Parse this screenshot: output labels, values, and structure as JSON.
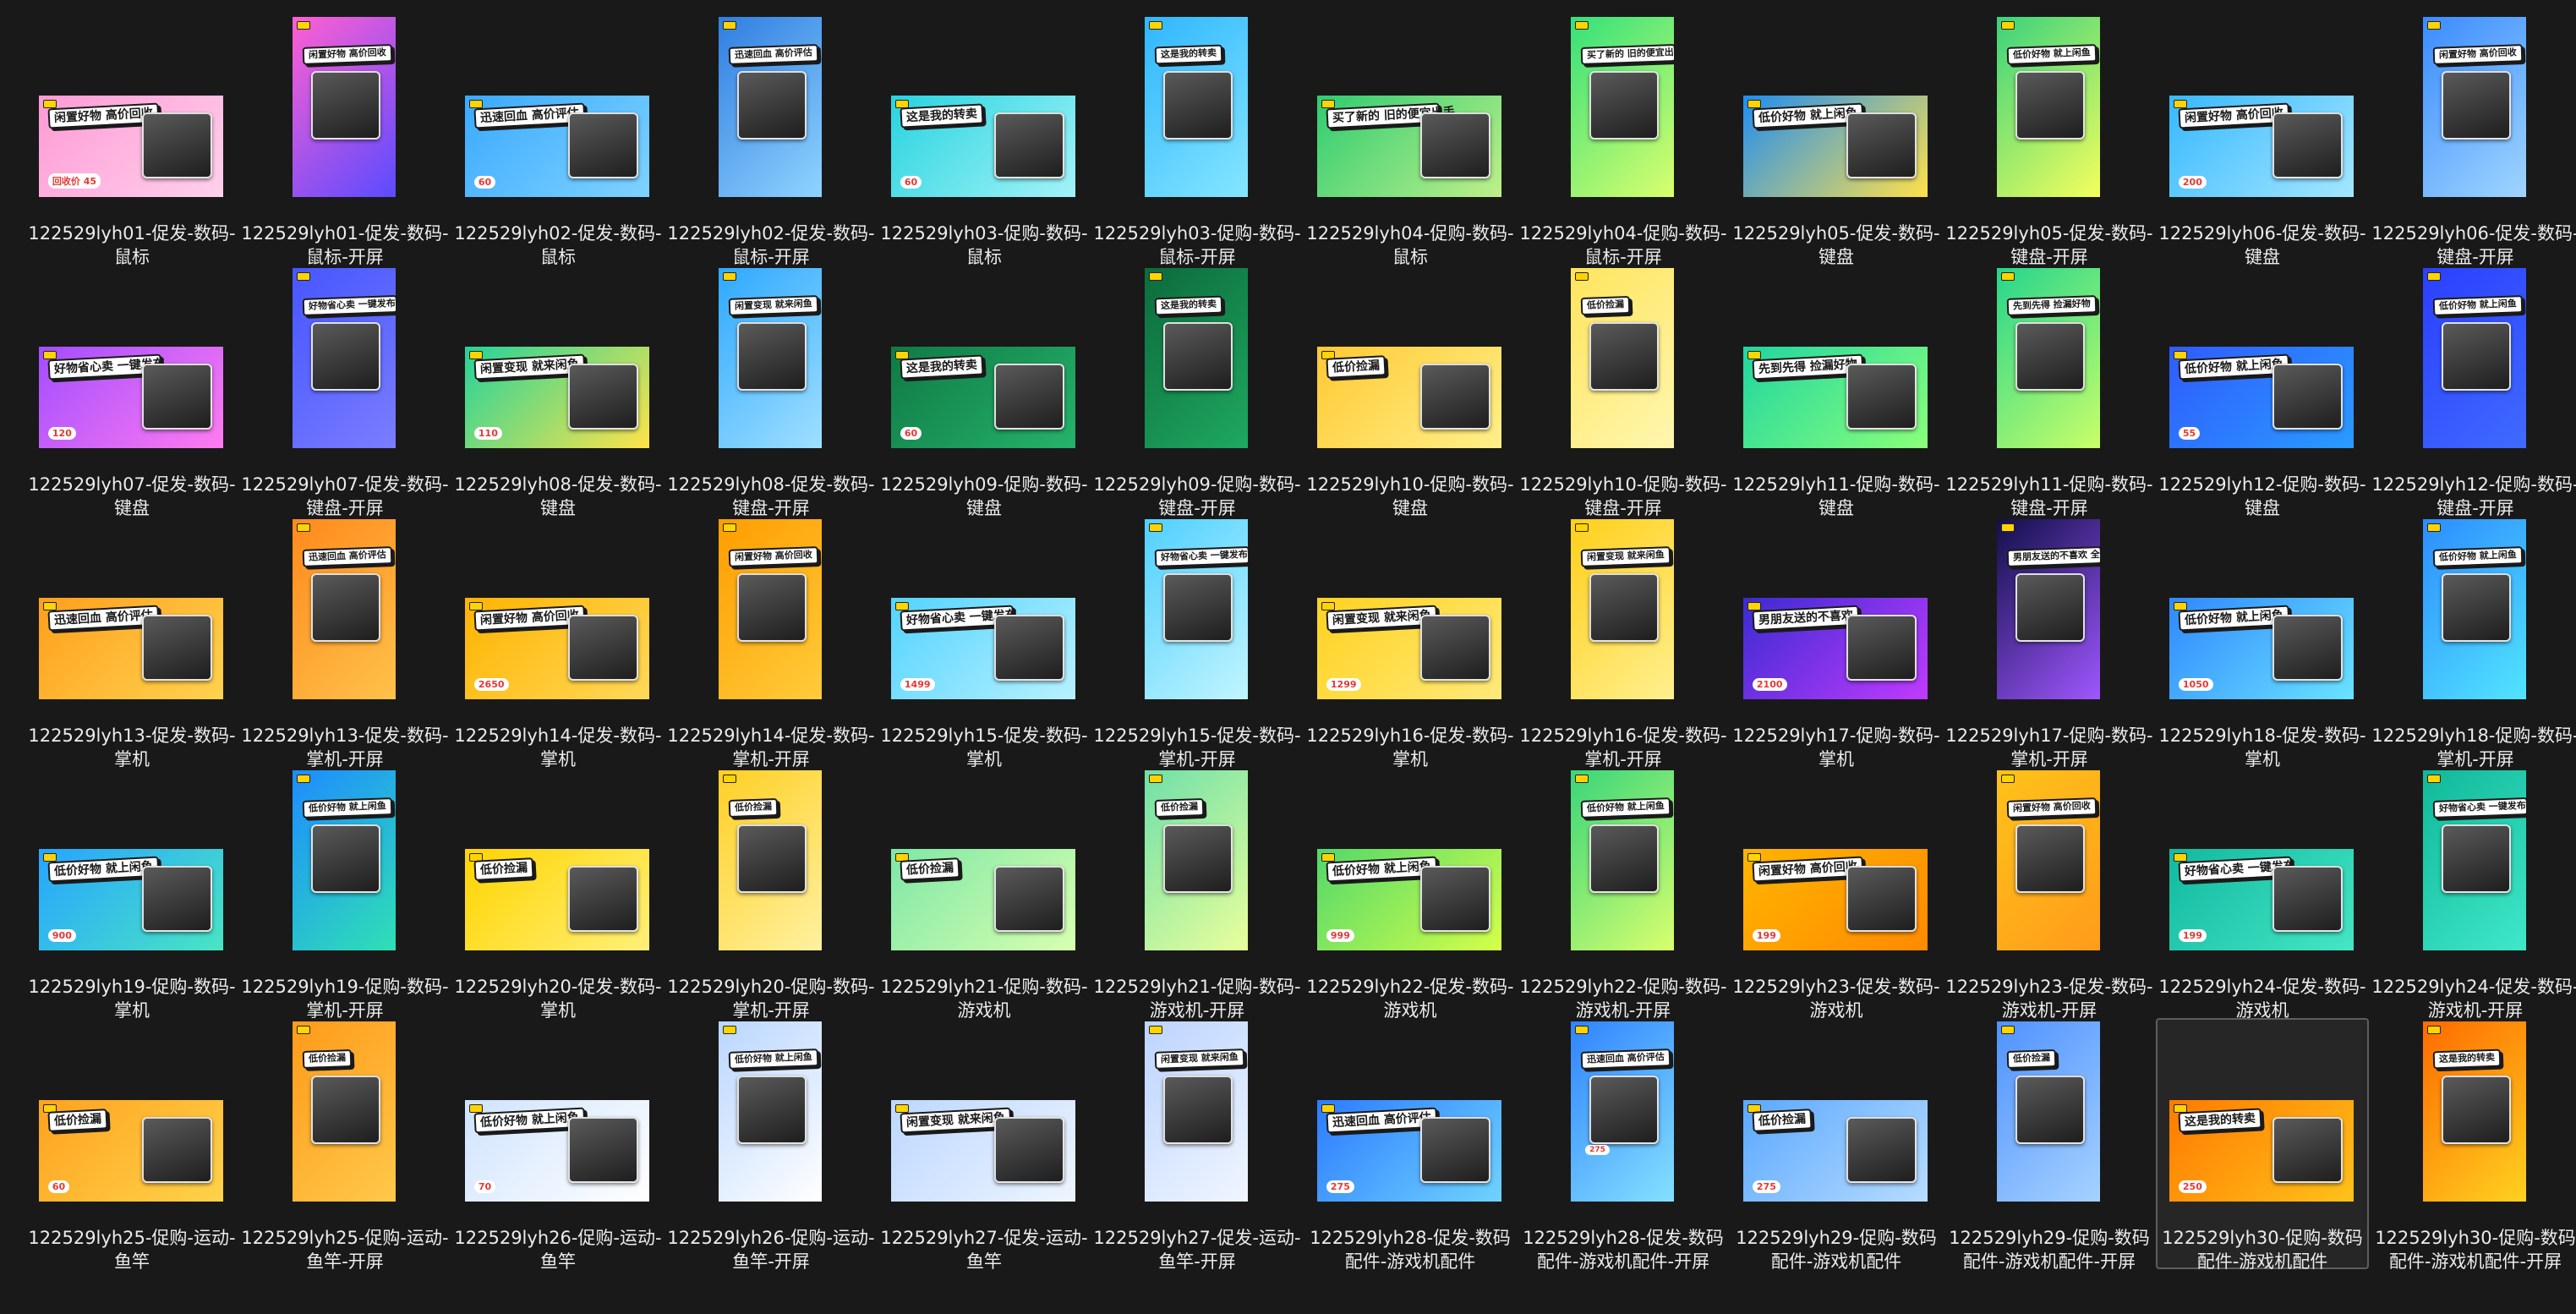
{
  "files": [
    {
      "name": "122529lyh01-促发-数码-鼠标",
      "orientation": "landscape",
      "headline": "闲置好物 高价回收",
      "price": "回收价 45",
      "colors": [
        "#ff9ad5",
        "#ffd1ec"
      ],
      "selected": false
    },
    {
      "name": "122529lyh01-促发-数码-鼠标-开屏",
      "orientation": "portrait",
      "headline": "闲置好物 高价回收",
      "price": "",
      "colors": [
        "#ff5fd2",
        "#5b4bff"
      ],
      "selected": false
    },
    {
      "name": "122529lyh02-促发-数码-鼠标",
      "orientation": "landscape",
      "headline": "迅速回血 高价评估",
      "price": "60",
      "colors": [
        "#3aa9ff",
        "#7fd3ff"
      ],
      "selected": false
    },
    {
      "name": "122529lyh02-促发-数码-鼠标-开屏",
      "orientation": "portrait",
      "headline": "迅速回血 高价评估",
      "price": "",
      "colors": [
        "#2f7de1",
        "#8fd4ff"
      ],
      "selected": false
    },
    {
      "name": "122529lyh03-促购-数码-鼠标",
      "orientation": "landscape",
      "headline": "这是我的转卖",
      "price": "60",
      "colors": [
        "#27d3e0",
        "#a3f3f7"
      ],
      "selected": false
    },
    {
      "name": "122529lyh03-促购-数码-鼠标-开屏",
      "orientation": "portrait",
      "headline": "这是我的转卖",
      "price": "",
      "colors": [
        "#2fb6ff",
        "#85e6ff"
      ],
      "selected": false
    },
    {
      "name": "122529lyh04-促购-数码-鼠标",
      "orientation": "landscape",
      "headline": "买了新的 旧的便宜出手",
      "price": "",
      "colors": [
        "#2ecc71",
        "#bff08a"
      ],
      "selected": false
    },
    {
      "name": "122529lyh04-促购-数码-鼠标-开屏",
      "orientation": "portrait",
      "headline": "买了新的 旧的便宜出手",
      "price": "",
      "colors": [
        "#34e07a",
        "#d9ff6e"
      ],
      "selected": false
    },
    {
      "name": "122529lyh05-促发-数码-键盘",
      "orientation": "landscape",
      "headline": "低价好物 就上闲鱼",
      "price": "",
      "colors": [
        "#1f8df2",
        "#ffe14a"
      ],
      "selected": false
    },
    {
      "name": "122529lyh05-促发-数码-键盘-开屏",
      "orientation": "portrait",
      "headline": "低价好物 就上闲鱼",
      "price": "",
      "colors": [
        "#39d27c",
        "#f4ff5e"
      ],
      "selected": false
    },
    {
      "name": "122529lyh06-促发-数码-键盘",
      "orientation": "landscape",
      "headline": "闲置好物 高价回收",
      "price": "200",
      "colors": [
        "#37b8ff",
        "#a4e7ff"
      ],
      "selected": false
    },
    {
      "name": "122529lyh06-促发-数码-键盘-开屏",
      "orientation": "portrait",
      "headline": "闲置好物 高价回收",
      "price": "",
      "colors": [
        "#3a8bff",
        "#9fd5ff"
      ],
      "selected": false
    },
    {
      "name": "122529lyh07-促发-数码-键盘",
      "orientation": "landscape",
      "headline": "好物省心卖 一键发布",
      "price": "120",
      "colors": [
        "#a24dff",
        "#ff7cf0"
      ],
      "selected": false
    },
    {
      "name": "122529lyh07-促发-数码-键盘-开屏",
      "orientation": "portrait",
      "headline": "好物省心卖 一键发布",
      "price": "",
      "colors": [
        "#4656ff",
        "#7a7dff"
      ],
      "selected": false
    },
    {
      "name": "122529lyh08-促发-数码-键盘",
      "orientation": "landscape",
      "headline": "闲置变现 就来闲鱼",
      "price": "110",
      "colors": [
        "#22d39a",
        "#ffe34a"
      ],
      "selected": false
    },
    {
      "name": "122529lyh08-促发-数码-键盘-开屏",
      "orientation": "portrait",
      "headline": "闲置变现 就来闲鱼",
      "price": "",
      "colors": [
        "#2ea8ff",
        "#9fe0ff"
      ],
      "selected": false
    },
    {
      "name": "122529lyh09-促购-数码-键盘",
      "orientation": "landscape",
      "headline": "这是我的转卖",
      "price": "60",
      "colors": [
        "#0f7a45",
        "#26b36b"
      ],
      "selected": false
    },
    {
      "name": "122529lyh09-促购-数码-键盘-开屏",
      "orientation": "portrait",
      "headline": "这是我的转卖",
      "price": "",
      "colors": [
        "#0c6b3c",
        "#1fa860"
      ],
      "selected": false
    },
    {
      "name": "122529lyh10-促购-数码-键盘",
      "orientation": "landscape",
      "headline": "低价捡漏",
      "price": "",
      "colors": [
        "#ffc933",
        "#fff08a"
      ],
      "selected": false
    },
    {
      "name": "122529lyh10-促购-数码-键盘-开屏",
      "orientation": "portrait",
      "headline": "低价捡漏",
      "price": "",
      "colors": [
        "#ffe45c",
        "#fff7b0"
      ],
      "selected": false
    },
    {
      "name": "122529lyh11-促购-数码-键盘",
      "orientation": "landscape",
      "headline": "先到先得 捡漏好物",
      "price": "",
      "colors": [
        "#1fd6a0",
        "#8bff7a"
      ],
      "selected": false
    },
    {
      "name": "122529lyh11-促购-数码-键盘-开屏",
      "orientation": "portrait",
      "headline": "先到先得 捡漏好物",
      "price": "",
      "colors": [
        "#25d58c",
        "#c9ff6a"
      ],
      "selected": false
    },
    {
      "name": "122529lyh12-促购-数码-键盘",
      "orientation": "landscape",
      "headline": "低价好物 就上闲鱼",
      "price": "55",
      "colors": [
        "#2f5cff",
        "#2a9bff"
      ],
      "selected": false
    },
    {
      "name": "122529lyh12-促购-数码-键盘-开屏",
      "orientation": "portrait",
      "headline": "低价好物 就上闲鱼",
      "price": "",
      "colors": [
        "#2b3fff",
        "#3f6bff"
      ],
      "selected": false
    },
    {
      "name": "122529lyh13-促发-数码-掌机",
      "orientation": "landscape",
      "headline": "迅速回血 高价评估",
      "price": "",
      "colors": [
        "#ff9f1c",
        "#ffd34f"
      ],
      "selected": false
    },
    {
      "name": "122529lyh13-促发-数码-掌机-开屏",
      "orientation": "portrait",
      "headline": "迅速回血 高价评估",
      "price": "",
      "colors": [
        "#ff8a1c",
        "#ffc24a"
      ],
      "selected": false
    },
    {
      "name": "122529lyh14-促发-数码-掌机",
      "orientation": "landscape",
      "headline": "闲置好物 高价回收",
      "price": "2650",
      "colors": [
        "#ffb300",
        "#ffd95a"
      ],
      "selected": false
    },
    {
      "name": "122529lyh14-促发-数码-掌机-开屏",
      "orientation": "portrait",
      "headline": "闲置好物 高价回收",
      "price": "",
      "colors": [
        "#ff9d00",
        "#ffcc3a"
      ],
      "selected": false
    },
    {
      "name": "122529lyh15-促发-数码-掌机",
      "orientation": "landscape",
      "headline": "好物省心卖 一键发布",
      "price": "1499",
      "colors": [
        "#53d3ff",
        "#b8f1ff"
      ],
      "selected": false
    },
    {
      "name": "122529lyh15-促发-数码-掌机-开屏",
      "orientation": "portrait",
      "headline": "好物省心卖 一键发布",
      "price": "",
      "colors": [
        "#4fd0ff",
        "#c2f5ff"
      ],
      "selected": false
    },
    {
      "name": "122529lyh16-促发-数码-掌机",
      "orientation": "landscape",
      "headline": "闲置变现 就来闲鱼",
      "price": "1299",
      "colors": [
        "#ffd21f",
        "#ffe97a"
      ],
      "selected": false
    },
    {
      "name": "122529lyh16-促发-数码-掌机-开屏",
      "orientation": "portrait",
      "headline": "闲置变现 就来闲鱼",
      "price": "",
      "colors": [
        "#ffcf1a",
        "#fff08f"
      ],
      "selected": false
    },
    {
      "name": "122529lyh17-促购-数码-掌机",
      "orientation": "landscape",
      "headline": "男朋友送的不喜欢",
      "price": "2100",
      "colors": [
        "#3b2bd1",
        "#c13bff"
      ],
      "selected": false
    },
    {
      "name": "122529lyh17-促购-数码-掌机-开屏",
      "orientation": "portrait",
      "headline": "男朋友送的不喜欢 全新低价出手",
      "price": "",
      "colors": [
        "#120f4a",
        "#9f57ff"
      ],
      "selected": false
    },
    {
      "name": "122529lyh18-促发-数码-掌机",
      "orientation": "landscape",
      "headline": "低价好物 就上闲鱼",
      "price": "1050",
      "colors": [
        "#2f88ff",
        "#6ae3ff"
      ],
      "selected": false
    },
    {
      "name": "122529lyh18-促购-数码-掌机-开屏",
      "orientation": "portrait",
      "headline": "低价好物 就上闲鱼",
      "price": "",
      "colors": [
        "#2c8cff",
        "#52e5ff"
      ],
      "selected": false
    },
    {
      "name": "122529lyh19-促购-数码-掌机",
      "orientation": "landscape",
      "headline": "低价好物 就上闲鱼",
      "price": "900",
      "colors": [
        "#27a4ff",
        "#49e5c3"
      ],
      "selected": false
    },
    {
      "name": "122529lyh19-促购-数码-掌机-开屏",
      "orientation": "portrait",
      "headline": "低价好物 就上闲鱼",
      "price": "",
      "colors": [
        "#1d8cff",
        "#2fe0b5"
      ],
      "selected": false
    },
    {
      "name": "122529lyh20-促发-数码-掌机",
      "orientation": "landscape",
      "headline": "低价捡漏",
      "price": "",
      "colors": [
        "#ffd400",
        "#fff07a"
      ],
      "selected": false
    },
    {
      "name": "122529lyh20-促购-数码-掌机-开屏",
      "orientation": "portrait",
      "headline": "低价捡漏",
      "price": "",
      "colors": [
        "#ffcf24",
        "#fff1a0"
      ],
      "selected": false
    },
    {
      "name": "122529lyh21-促购-数码-游戏机",
      "orientation": "landscape",
      "headline": "低价捡漏",
      "price": "",
      "colors": [
        "#7ee7a6",
        "#d8ffb0"
      ],
      "selected": false
    },
    {
      "name": "122529lyh21-促购-数码-游戏机-开屏",
      "orientation": "portrait",
      "headline": "低价捡漏",
      "price": "",
      "colors": [
        "#6fe0a8",
        "#e9ff9c"
      ],
      "selected": false
    },
    {
      "name": "122529lyh22-促发-数码-游戏机",
      "orientation": "landscape",
      "headline": "低价好物 就上闲鱼",
      "price": "999",
      "colors": [
        "#52d86a",
        "#d4ff4a"
      ],
      "selected": false
    },
    {
      "name": "122529lyh22-促购-数码-游戏机-开屏",
      "orientation": "portrait",
      "headline": "低价好物 就上闲鱼",
      "price": "",
      "colors": [
        "#38d67a",
        "#d8ff6e"
      ],
      "selected": false
    },
    {
      "name": "122529lyh23-促发-数码-游戏机",
      "orientation": "landscape",
      "headline": "闲置好物 高价回收",
      "price": "199",
      "colors": [
        "#ffb400",
        "#ff8a00"
      ],
      "selected": false
    },
    {
      "name": "122529lyh23-促发-数码-游戏机-开屏",
      "orientation": "portrait",
      "headline": "闲置好物 高价回收",
      "price": "",
      "colors": [
        "#ffc21a",
        "#ff9c1a"
      ],
      "selected": false
    },
    {
      "name": "122529lyh24-促发-数码-游戏机",
      "orientation": "landscape",
      "headline": "好物省心卖 一键发布",
      "price": "199",
      "colors": [
        "#12b9a0",
        "#44e6c4"
      ],
      "selected": false
    },
    {
      "name": "122529lyh24-促发-数码-游戏机-开屏",
      "orientation": "portrait",
      "headline": "好物省心卖 一键发布",
      "price": "",
      "colors": [
        "#10b89a",
        "#3fe8c8"
      ],
      "selected": false
    },
    {
      "name": "122529lyh25-促购-运动-鱼竿",
      "orientation": "landscape",
      "headline": "低价捡漏",
      "price": "60",
      "colors": [
        "#ffa21f",
        "#ffd34a"
      ],
      "selected": false
    },
    {
      "name": "122529lyh25-促购-运动-鱼竿-开屏",
      "orientation": "portrait",
      "headline": "低价捡漏",
      "price": "",
      "colors": [
        "#ff9a1a",
        "#ffc94a"
      ],
      "selected": false
    },
    {
      "name": "122529lyh26-促购-运动-鱼竿",
      "orientation": "landscape",
      "headline": "低价好物 就上闲鱼",
      "price": "70",
      "colors": [
        "#cfe3ff",
        "#ffffff"
      ],
      "selected": false
    },
    {
      "name": "122529lyh26-促购-运动-鱼竿-开屏",
      "orientation": "portrait",
      "headline": "低价好物 就上闲鱼",
      "price": "",
      "colors": [
        "#b9d6ff",
        "#ffffff"
      ],
      "selected": false
    },
    {
      "name": "122529lyh27-促发-运动-鱼竿",
      "orientation": "landscape",
      "headline": "闲置变现 就来闲鱼",
      "price": "",
      "colors": [
        "#bcd7ff",
        "#eef5ff"
      ],
      "selected": false
    },
    {
      "name": "122529lyh27-促发-运动-鱼竿-开屏",
      "orientation": "portrait",
      "headline": "闲置变现 就来闲鱼",
      "price": "",
      "colors": [
        "#bcd4ff",
        "#f1f6ff"
      ],
      "selected": false
    },
    {
      "name": "122529lyh28-促发-数码配件-游戏机配件",
      "orientation": "landscape",
      "headline": "迅速回血 高价评估",
      "price": "275",
      "colors": [
        "#2c7bff",
        "#6fd3ff"
      ],
      "selected": false
    },
    {
      "name": "122529lyh28-促发-数码配件-游戏机配件-开屏",
      "orientation": "portrait",
      "headline": "迅速回血 高价评估",
      "price": "275",
      "colors": [
        "#2f83ff",
        "#84e1ff"
      ],
      "selected": false
    },
    {
      "name": "122529lyh29-促购-数码配件-游戏机配件",
      "orientation": "landscape",
      "headline": "低价捡漏",
      "price": "275",
      "colors": [
        "#5aa8ff",
        "#b7dcff"
      ],
      "selected": false
    },
    {
      "name": "122529lyh29-促购-数码配件-游戏机配件-开屏",
      "orientation": "portrait",
      "headline": "低价捡漏",
      "price": "",
      "colors": [
        "#4f92ff",
        "#a6d2ff"
      ],
      "selected": false
    },
    {
      "name": "122529lyh30-促购-数码配件-游戏机配件",
      "orientation": "landscape",
      "headline": "这是我的转卖",
      "price": "250",
      "colors": [
        "#ff7a00",
        "#ffc21a"
      ],
      "selected": true
    },
    {
      "name": "122529lyh30-促购-数码配件-游戏机配件-开屏",
      "orientation": "portrait",
      "headline": "这是我的转卖",
      "price": "",
      "colors": [
        "#ff6a00",
        "#ffd21f"
      ],
      "selected": false
    }
  ]
}
